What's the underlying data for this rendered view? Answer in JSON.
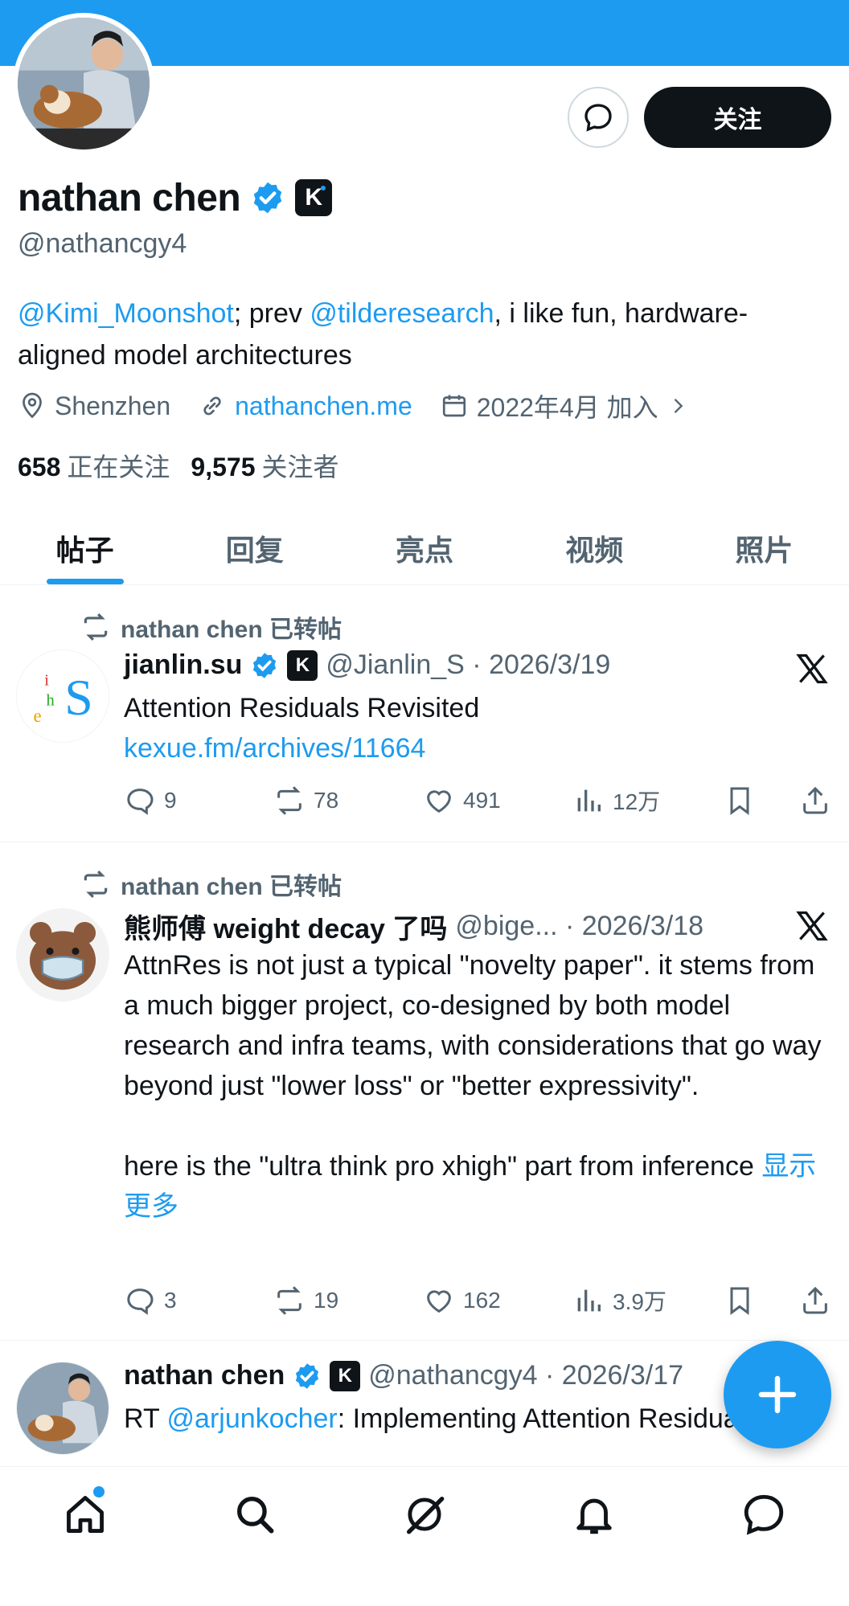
{
  "profile": {
    "name": "nathan chen",
    "handle": "@nathancgy4",
    "bio_mention1": "@Kimi_Moonshot",
    "bio_mid": "; prev ",
    "bio_mention2": "@tilderesearch",
    "bio_rest": ", i like fun, hardware-aligned model architectures",
    "location": "Shenzhen",
    "website": "nathanchen.me",
    "joined": "2022年4月 加入",
    "following_count": "658",
    "following_label": "正在关注",
    "followers_count": "9,575",
    "followers_label": "关注者",
    "badge_letter": "K",
    "follow_label": "关注"
  },
  "tabs": [
    {
      "label": "帖子",
      "active": true
    },
    {
      "label": "回复"
    },
    {
      "label": "亮点"
    },
    {
      "label": "视频"
    },
    {
      "label": "照片"
    }
  ],
  "posts": [
    {
      "repost_label": "nathan chen 已转帖",
      "author": "jianlin.su",
      "badge_letter": "K",
      "handle_date": "@Jianlin_S · 2026/3/19",
      "text": "Attention Residuals Revisited",
      "link": "kexue.fm/archives/11664",
      "replies": "9",
      "reposts": "78",
      "likes": "491",
      "views": "12万"
    },
    {
      "repost_label": "nathan chen 已转帖",
      "author": "熊师傅 weight decay 了吗",
      "handle_date": "@bige... · 2026/3/18",
      "text": "AttnRes is not just a typical \"novelty paper\". it stems from a much bigger project, co-designed by both model research and infra teams, with considerations that go way beyond just \"lower loss\" or \"better expressivity\".\n\nhere is the \"ultra think pro xhigh\" part from inference ",
      "show_more": "显示更多",
      "replies": "3",
      "reposts": "19",
      "likes": "162",
      "views": "3.9万"
    },
    {
      "author": "nathan chen",
      "badge_letter": "K",
      "handle_date": "@nathancgy4 · 2026/3/17",
      "text_prefix": "RT ",
      "mention": "@arjunkocher",
      "text_rest": ": Implementing Attention Residuals"
    }
  ],
  "colors": {
    "accent": "#1d9bf0",
    "text": "#0f1419",
    "secondary": "#536471",
    "button_dark": "#0f1419"
  },
  "icons": [
    "message-icon",
    "verified-icon",
    "location-icon",
    "link-icon",
    "calendar-icon",
    "chevron-right-icon",
    "repost-icon",
    "x-logo-icon",
    "reply-icon",
    "like-icon",
    "views-icon",
    "bookmark-icon",
    "share-icon",
    "plus-icon",
    "home-icon",
    "search-icon",
    "grok-icon",
    "bell-icon",
    "messages-icon"
  ]
}
